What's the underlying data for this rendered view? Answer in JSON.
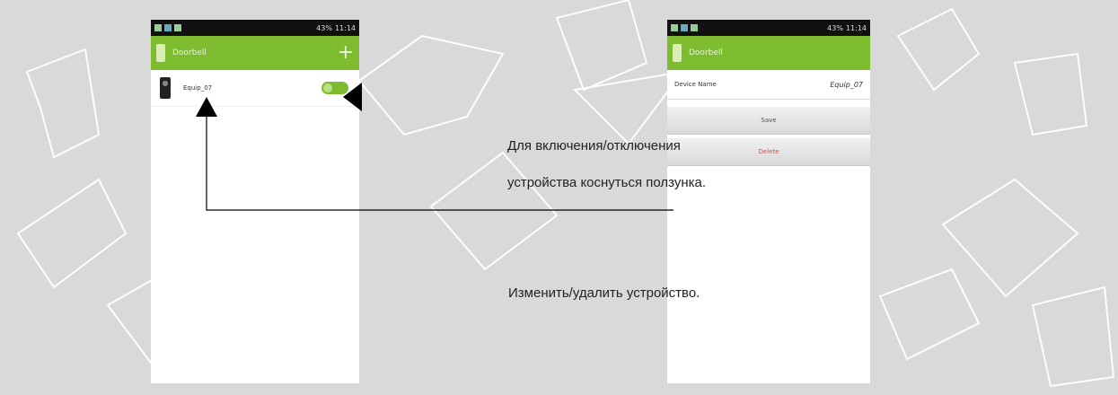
{
  "left_phone": {
    "status_time": "11:14",
    "status_battery": "43%",
    "header_title": "Doorbell",
    "add_symbol": "+",
    "device_name": "Equip_07",
    "toggle_on": true
  },
  "right_phone": {
    "status_time": "11:14",
    "status_battery": "43%",
    "header_title": "Doorbell",
    "field_label": "Device Name",
    "field_value": "Equip_07",
    "button_1": "Save",
    "button_2": "Delete"
  },
  "annotations": {
    "toggle_hint_line1": "Для включения/отключения",
    "toggle_hint_line2": "устройства коснуться ползунка.",
    "edit_hint": "Изменить/удалить устройство."
  },
  "colors": {
    "accent_green": "#7cbc2e",
    "background": "#d9d9d9"
  }
}
